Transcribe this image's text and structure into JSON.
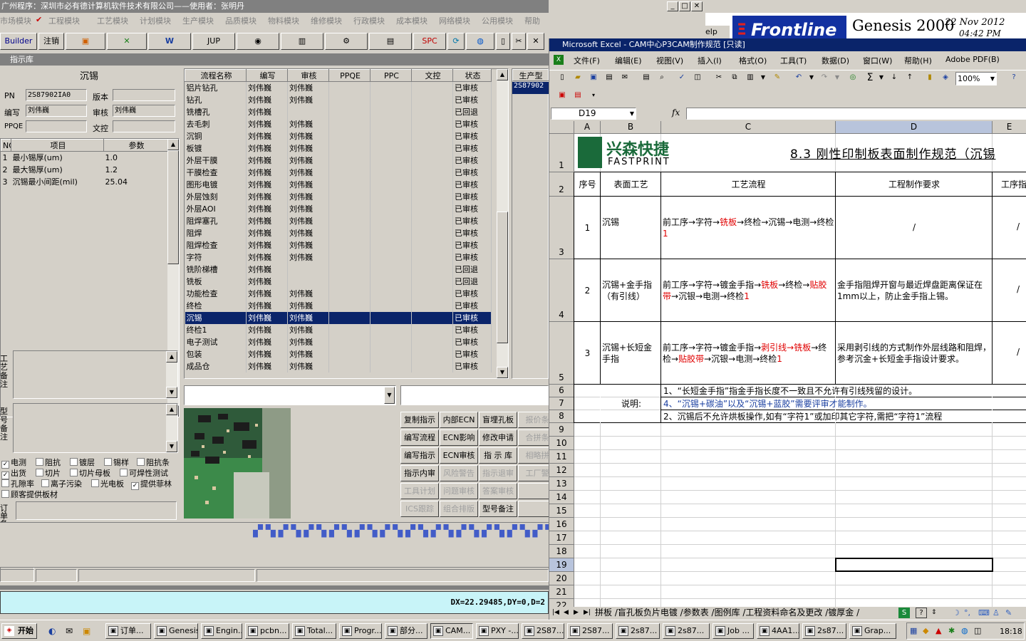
{
  "left_window": {
    "title": "广州程序：深圳市必有德计算机软件技术有限公司——使用者：张明丹",
    "menu": [
      "市场模块",
      "工程模块",
      "工艺模块",
      "计划模块",
      "生产模块",
      "品质模块",
      "物料模块",
      "维修模块",
      "行政模块",
      "成本模块",
      "网络模块",
      "公用模块",
      "帮助"
    ],
    "toolbar": {
      "builder": "Builder",
      "logout": "注销",
      "jup": "JUP",
      "spc": "SPC"
    },
    "panel_title": "指示库",
    "section_title": "沉锡",
    "fields": {
      "pn_label": "PN",
      "pn_value": "2S87902IA0",
      "version_label": "版本",
      "version_value": "",
      "author_label": "编写",
      "author_value": "刘伟巍",
      "review_label": "审核",
      "review_value": "刘伟巍",
      "ppqe_label": "PPQE",
      "ppqe_value": "",
      "wenkong_label": "文控",
      "wenkong_value": ""
    },
    "param_headers": [
      "NO",
      "项目",
      "参数"
    ],
    "params": [
      {
        "no": "1",
        "item": "最小锡厚(um)",
        "value": "1.0"
      },
      {
        "no": "2",
        "item": "最大锡厚(um)",
        "value": "1.2"
      },
      {
        "no": "3",
        "item": "沉锡最小间距(mil)",
        "value": "25.04"
      }
    ],
    "notes_labels": {
      "process": "工艺备注",
      "model": "型号备注",
      "order": "订单备注"
    },
    "checkboxes": [
      {
        "label": "电测",
        "checked": true
      },
      {
        "label": "阻抗",
        "checked": false
      },
      {
        "label": "镀层",
        "checked": false
      },
      {
        "label": "锡样",
        "checked": false
      },
      {
        "label": "阻抗条",
        "checked": false
      },
      {
        "label": "出货",
        "checked": true
      },
      {
        "label": "切片",
        "checked": false
      },
      {
        "label": "切片母板",
        "checked": false
      },
      {
        "label": "可焊性测试",
        "checked": false
      },
      {
        "label": "孔隙率",
        "checked": false
      },
      {
        "label": "离子污染",
        "checked": false
      },
      {
        "label": "光电板",
        "checked": false
      },
      {
        "label": "提供菲林",
        "checked": true
      },
      {
        "label": "顾客提供板材",
        "checked": false
      }
    ],
    "flow_headers": [
      "流程名称",
      "编写",
      "审核",
      "PPQE",
      "PPC",
      "文控",
      "状态"
    ],
    "flow_rows": [
      {
        "name": "铝片钻孔",
        "author": "刘伟巍",
        "review": "刘伟巍",
        "status": "已审核"
      },
      {
        "name": "钻孔",
        "author": "刘伟巍",
        "review": "刘伟巍",
        "status": "已审核"
      },
      {
        "name": "铣槽孔",
        "author": "刘伟巍",
        "review": "",
        "status": "已回退"
      },
      {
        "name": "去毛刺",
        "author": "刘伟巍",
        "review": "刘伟巍",
        "status": "已审核"
      },
      {
        "name": "沉铜",
        "author": "刘伟巍",
        "review": "刘伟巍",
        "status": "已审核"
      },
      {
        "name": "板镀",
        "author": "刘伟巍",
        "review": "刘伟巍",
        "status": "已审核"
      },
      {
        "name": "外层干膜",
        "author": "刘伟巍",
        "review": "刘伟巍",
        "status": "已审核"
      },
      {
        "name": "干膜检查",
        "author": "刘伟巍",
        "review": "刘伟巍",
        "status": "已审核"
      },
      {
        "name": "图形电镀",
        "author": "刘伟巍",
        "review": "刘伟巍",
        "status": "已审核"
      },
      {
        "name": "外层蚀刻",
        "author": "刘伟巍",
        "review": "刘伟巍",
        "status": "已审核"
      },
      {
        "name": "外层AOI",
        "author": "刘伟巍",
        "review": "刘伟巍",
        "status": "已审核"
      },
      {
        "name": "阻焊塞孔",
        "author": "刘伟巍",
        "review": "刘伟巍",
        "status": "已审核"
      },
      {
        "name": "阻焊",
        "author": "刘伟巍",
        "review": "刘伟巍",
        "status": "已审核"
      },
      {
        "name": "阻焊检查",
        "author": "刘伟巍",
        "review": "刘伟巍",
        "status": "已审核"
      },
      {
        "name": "字符",
        "author": "刘伟巍",
        "review": "刘伟巍",
        "status": "已审核"
      },
      {
        "name": "铣阶梯槽",
        "author": "刘伟巍",
        "review": "",
        "status": "已回退"
      },
      {
        "name": "铣板",
        "author": "刘伟巍",
        "review": "",
        "status": "已回退"
      },
      {
        "name": "功能检查",
        "author": "刘伟巍",
        "review": "刘伟巍",
        "status": "已审核"
      },
      {
        "name": "终检",
        "author": "刘伟巍",
        "review": "刘伟巍",
        "status": "已审核"
      },
      {
        "name": "沉锡",
        "author": "刘伟巍",
        "review": "刘伟巍",
        "status": "已审核",
        "selected": true
      },
      {
        "name": "终检1",
        "author": "刘伟巍",
        "review": "刘伟巍",
        "status": "已审核"
      },
      {
        "name": "电子测试",
        "author": "刘伟巍",
        "review": "刘伟巍",
        "status": "已审核"
      },
      {
        "name": "包装",
        "author": "刘伟巍",
        "review": "刘伟巍",
        "status": "已审核"
      },
      {
        "name": "成品仓",
        "author": "刘伟巍",
        "review": "刘伟巍",
        "status": "已审核"
      }
    ],
    "prod_header": "生产型",
    "prod_value": "2S87902",
    "action_buttons": [
      {
        "label": "复制指示",
        "enabled": true
      },
      {
        "label": "内部ECN",
        "enabled": true
      },
      {
        "label": "盲埋孔板",
        "enabled": true
      },
      {
        "label": "报价条",
        "enabled": false
      },
      {
        "label": "编写流程",
        "enabled": true
      },
      {
        "label": "ECN影响",
        "enabled": true
      },
      {
        "label": "修改申请",
        "enabled": true
      },
      {
        "label": "合拼条",
        "enabled": false
      },
      {
        "label": "编写指示",
        "enabled": true
      },
      {
        "label": "ECN审核",
        "enabled": true
      },
      {
        "label": "指 示 库",
        "enabled": true
      },
      {
        "label": "相略拼",
        "enabled": false
      },
      {
        "label": "指示内审",
        "enabled": true
      },
      {
        "label": "风险警告",
        "enabled": false
      },
      {
        "label": "指示退审",
        "enabled": false
      },
      {
        "label": "工厂警",
        "enabled": false
      },
      {
        "label": "工具计划",
        "enabled": false
      },
      {
        "label": "问题审核",
        "enabled": false
      },
      {
        "label": "答案审核",
        "enabled": false
      },
      {
        "label": "",
        "enabled": false
      },
      {
        "label": "ICS跟踪",
        "enabled": false
      },
      {
        "label": "组合排版",
        "enabled": false
      },
      {
        "label": "型号备注",
        "enabled": true
      },
      {
        "label": "",
        "enabled": false
      }
    ],
    "command_text": "DX=22.29485,DY=0,D=2"
  },
  "genesis": {
    "logo": "Frontline",
    "title": "Genesis 2000",
    "date": "22 Nov 2012",
    "time": "04:42 PM",
    "hint": "elp"
  },
  "excel": {
    "title": "Microsoft Excel - CAM中心P3CAM制作规范 [只读]",
    "menu": [
      "文件(F)",
      "编辑(E)",
      "视图(V)",
      "插入(I)",
      "格式(O)",
      "工具(T)",
      "数据(D)",
      "窗口(W)",
      "帮助(H)",
      "Adobe PDF(B)"
    ],
    "zoom": "100%",
    "name_box": "D19",
    "fx": "fx",
    "columns": [
      "A",
      "B",
      "C",
      "D",
      "E"
    ],
    "rows": [
      "1",
      "2",
      "3",
      "4",
      "5",
      "6",
      "7",
      "8",
      "9",
      "10",
      "11",
      "12",
      "13",
      "14",
      "15",
      "16",
      "17",
      "18",
      "19",
      "20",
      "21",
      "22"
    ],
    "logo_cn": "兴森快捷",
    "logo_en": "FASTPRINT",
    "sheet_title": "8.3 刚性印制板表面制作规范（沉锡",
    "headers": {
      "seq": "序号",
      "surface": "表面工艺",
      "flow": "工艺流程",
      "requirement": "工程制作要求",
      "step": "工序指"
    },
    "table": [
      {
        "seq": "1",
        "surface": "沉锡",
        "flow": [
          "前工序→字符→",
          "铣板",
          "→终检→沉锡→电测→终检",
          "1"
        ],
        "req": "/",
        "step": "/"
      },
      {
        "seq": "2",
        "surface": "沉锡+金手指（有引线）",
        "flow": [
          "前工序→字符→镀金手指→",
          "铣板",
          "→终检→",
          "贴胶带",
          "→沉银→电测→终检",
          "1"
        ],
        "req": "金手指阻焊开窗与最近焊盘距离保证在1mm以上，防止金手指上锡。",
        "step": "/"
      },
      {
        "seq": "3",
        "surface": "沉锡+长短金手指",
        "flow": [
          "前工序→字符→镀金手指→",
          "剥引线→铣板",
          "→终检→",
          "贴胶带",
          "→沉银→电测→终检",
          "1"
        ],
        "req": "采用剥引线的方式制作外层线路和阻焊，参考沉金+长短金手指设计要求。",
        "step": "/"
      }
    ],
    "note_label": "说明:",
    "notes": [
      "1、“长短金手指”指金手指长度不一致且不允许有引线残留的设计。",
      "4、“沉锡+碳油”以及“沉锡+蓝胶”需要评审才能制作。",
      "2、沉锡后不允许烘板操作,如有“字符1”或加印其它字符,需把“字符1”流程"
    ],
    "sheet_tabs": "拼板 /盲孔板负片电镀 /参数表 /图例库 /工程资料命名及更改 /镀厚金 /"
  },
  "taskbar": {
    "start": "开始",
    "items": [
      "订单...",
      "Genesis",
      "Engin...",
      "pcbn...",
      "Total...",
      "Progr...",
      "部分...",
      "CAM...",
      "PXY -...",
      "2S87...",
      "2S87...",
      "2s87...",
      "2s87...",
      "Job ...",
      "4AA1...",
      "2s87...",
      "Grap..."
    ],
    "clock": "18:18"
  },
  "colors": {
    "title_active": "#0a246a",
    "selection": "#0a246a",
    "red_text": "#e00000",
    "face": "#d4d0c8"
  }
}
